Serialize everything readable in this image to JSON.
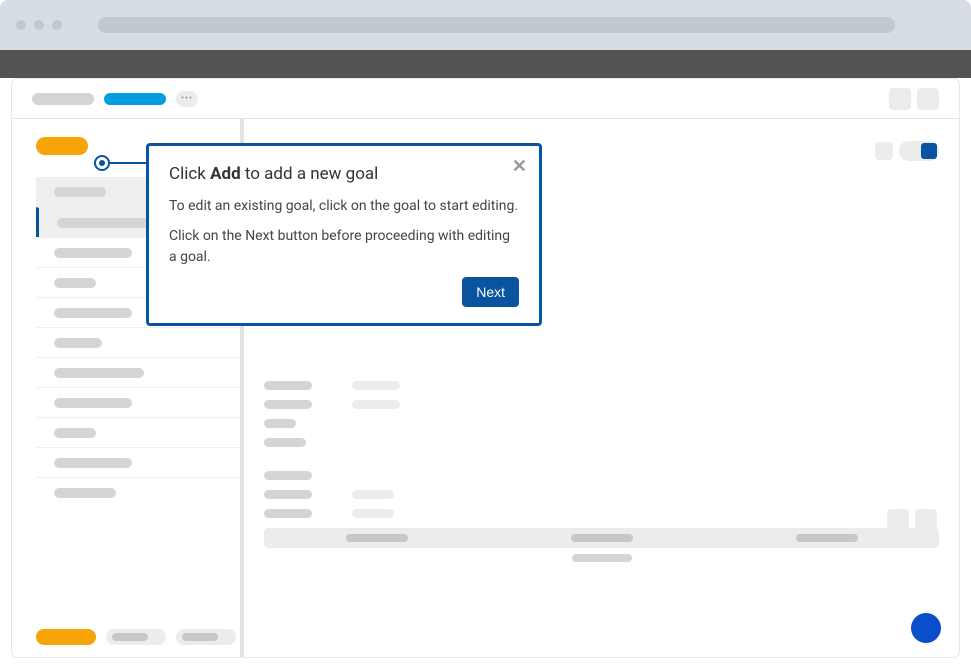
{
  "popover": {
    "title_prefix": "Click ",
    "title_bold": "Add",
    "title_suffix": " to add a new goal",
    "body_p1": "To edit an existing goal, click on the goal to start editing.",
    "body_p2": "Click on the Next button before proceeding with editing a goal.",
    "next_label": "Next",
    "close_label": "✕"
  }
}
